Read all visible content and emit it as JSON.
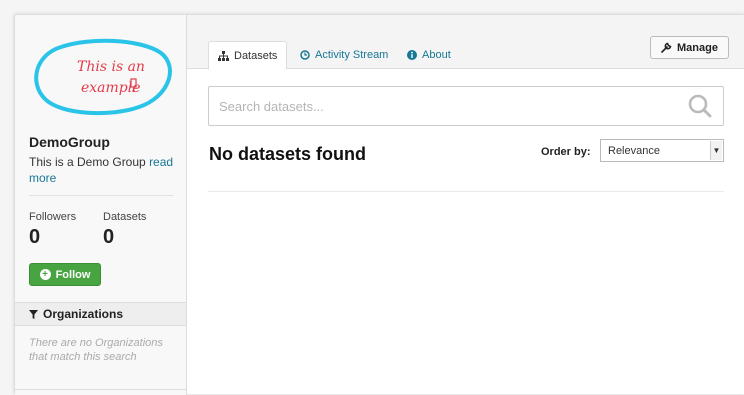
{
  "group": {
    "logo_text_line1": "This is an",
    "logo_text_line2": "example",
    "name": "DemoGroup",
    "description": "This is a Demo Group",
    "read_more": "read more"
  },
  "stats": {
    "followers_label": "Followers",
    "followers_value": "0",
    "datasets_label": "Datasets",
    "datasets_value": "0"
  },
  "follow_button": {
    "label": "Follow",
    "icon": "plus-circle-icon"
  },
  "organizations": {
    "heading": "Organizations",
    "icon": "filter-icon",
    "empty_text": "There are no Organizations that match this search"
  },
  "tabs": [
    {
      "label": "Datasets",
      "icon": "sitemap-icon",
      "active": true
    },
    {
      "label": "Activity Stream",
      "icon": "clock-icon",
      "active": false
    },
    {
      "label": "About",
      "icon": "info-icon",
      "active": false
    }
  ],
  "manage_button": {
    "label": "Manage",
    "icon": "wrench-icon"
  },
  "search": {
    "placeholder": "Search datasets...",
    "value": "",
    "icon": "search-icon"
  },
  "results": {
    "title": "No datasets found"
  },
  "order": {
    "label": "Order by:",
    "selected": "Relevance"
  },
  "colors": {
    "link": "#187794",
    "follow_green": "#48a441",
    "logo_blue": "#29c4e8",
    "logo_red": "#e23c4a"
  }
}
